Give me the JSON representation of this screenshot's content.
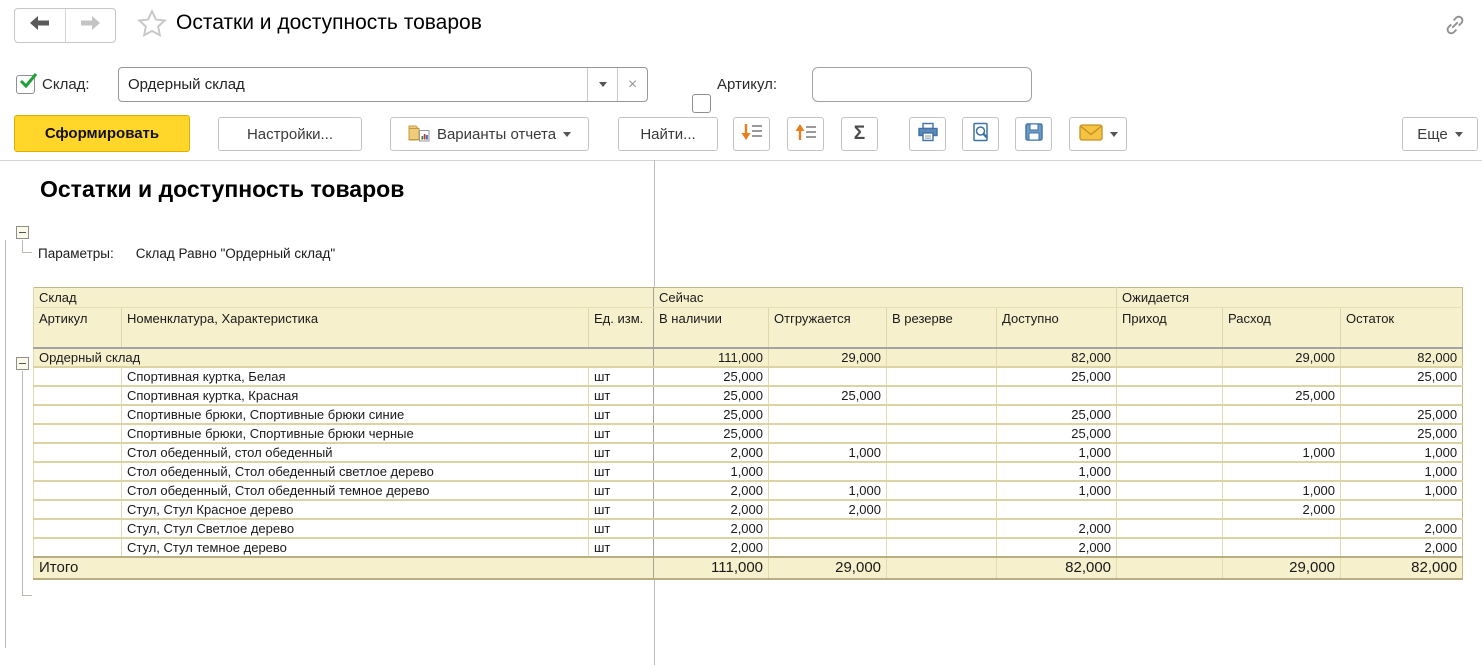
{
  "window": {
    "title": "Остатки и доступность товаров"
  },
  "colors": {
    "accent_yellow": "#FFD629",
    "table_header_bg": "#F7F0CD",
    "check_green": "#21A038",
    "icon_orange": "#E87E1E",
    "icon_blue": "#3F72A6",
    "envelope_yellow": "#F4C341"
  },
  "filters": {
    "sklad": {
      "checked": true,
      "label": "Склад:",
      "value": "Ордерный склад"
    },
    "artikul": {
      "checked": false,
      "label": "Артикул:",
      "value": ""
    }
  },
  "toolbar": {
    "generate": "Сформировать",
    "settings": "Настройки...",
    "variants": "Варианты отчета",
    "find": "Найти...",
    "sum_glyph": "Σ",
    "more": "Еще"
  },
  "report": {
    "title": "Остатки и доступность товаров",
    "params_label": "Параметры:",
    "params_value": "Склад Равно \"Ордерный склад\""
  },
  "table": {
    "group_headers": [
      "Склад",
      "Сейчас",
      "Ожидается"
    ],
    "columns": [
      "Артикул",
      "Номенклатура, Характеристика",
      "Ед. изм.",
      "В наличии",
      "Отгружается",
      "В резерве",
      "Доступно",
      "Приход",
      "Расход",
      "Остаток"
    ],
    "rows": [
      {
        "type": "group",
        "name": "Ордерный склад",
        "unit": "",
        "values": [
          "111,000",
          "29,000",
          "",
          "82,000",
          "",
          "29,000",
          "82,000"
        ]
      },
      {
        "type": "item",
        "name": "Спортивная куртка, Белая",
        "unit": "шт",
        "values": [
          "25,000",
          "",
          "",
          "25,000",
          "",
          "",
          "25,000"
        ]
      },
      {
        "type": "item",
        "name": "Спортивная куртка, Красная",
        "unit": "шт",
        "values": [
          "25,000",
          "25,000",
          "",
          "",
          "",
          "25,000",
          ""
        ]
      },
      {
        "type": "item",
        "name": "Спортивные брюки, Спортивные брюки синие",
        "unit": "шт",
        "values": [
          "25,000",
          "",
          "",
          "25,000",
          "",
          "",
          "25,000"
        ]
      },
      {
        "type": "item",
        "name": "Спортивные брюки, Спортивные брюки черные",
        "unit": "шт",
        "values": [
          "25,000",
          "",
          "",
          "25,000",
          "",
          "",
          "25,000"
        ]
      },
      {
        "type": "item",
        "name": "Стол обеденный, стол обеденный",
        "unit": "шт",
        "values": [
          "2,000",
          "1,000",
          "",
          "1,000",
          "",
          "1,000",
          "1,000"
        ]
      },
      {
        "type": "item",
        "name": "Стол обеденный, Стол обеденный светлое дерево",
        "unit": "шт",
        "values": [
          "1,000",
          "",
          "",
          "1,000",
          "",
          "",
          "1,000"
        ]
      },
      {
        "type": "item",
        "name": "Стол обеденный, Стол обеденный темное дерево",
        "unit": "шт",
        "values": [
          "2,000",
          "1,000",
          "",
          "1,000",
          "",
          "1,000",
          "1,000"
        ]
      },
      {
        "type": "item",
        "name": "Стул, Стул Красное дерево",
        "unit": "шт",
        "values": [
          "2,000",
          "2,000",
          "",
          "",
          "",
          "2,000",
          ""
        ]
      },
      {
        "type": "item",
        "name": "Стул, Стул Светлое дерево",
        "unit": "шт",
        "values": [
          "2,000",
          "",
          "",
          "2,000",
          "",
          "",
          "2,000"
        ]
      },
      {
        "type": "item",
        "name": "Стул, Стул темное дерево",
        "unit": "шт",
        "values": [
          "2,000",
          "",
          "",
          "2,000",
          "",
          "",
          "2,000"
        ]
      }
    ],
    "total": {
      "label": "Итого",
      "values": [
        "111,000",
        "29,000",
        "",
        "82,000",
        "",
        "29,000",
        "82,000"
      ]
    }
  }
}
